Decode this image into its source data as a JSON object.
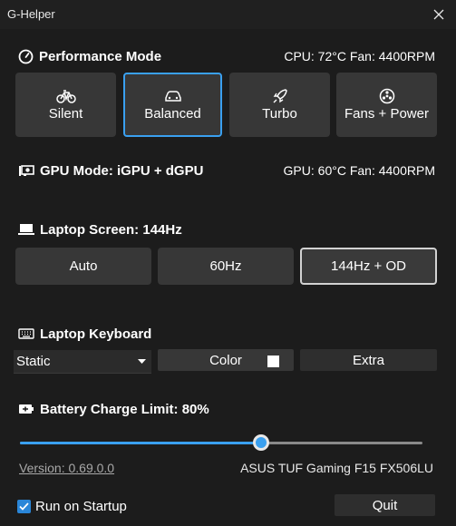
{
  "window": {
    "title": "G-Helper"
  },
  "performance": {
    "heading": "Performance Mode",
    "status": "CPU: 72°C  Fan: 4400RPM",
    "modes": [
      {
        "label": "Silent",
        "icon": "bicycle-icon"
      },
      {
        "label": "Balanced",
        "icon": "car-icon",
        "selected": true
      },
      {
        "label": "Turbo",
        "icon": "rocket-icon"
      },
      {
        "label": "Fans + Power",
        "icon": "fan-icon"
      }
    ]
  },
  "gpu": {
    "heading": "GPU Mode: iGPU + dGPU",
    "status": "GPU: 60°C  Fan: 4400RPM"
  },
  "screen": {
    "heading": "Laptop Screen: 144Hz",
    "options": [
      {
        "label": "Auto"
      },
      {
        "label": "60Hz"
      },
      {
        "label": "144Hz + OD",
        "selected": true
      }
    ]
  },
  "keyboard": {
    "heading": "Laptop Keyboard",
    "mode_value": "Static",
    "color_label": "Color",
    "extra_label": "Extra",
    "color": "#ffffff"
  },
  "battery": {
    "heading": "Battery Charge Limit: 80%",
    "limit_percent": 80,
    "slider_fraction": 0.6
  },
  "footer": {
    "version": "Version: 0.69.0.0",
    "model": "ASUS TUF Gaming F15 FX506LU",
    "startup_label": "Run on Startup",
    "startup_checked": true,
    "quit_label": "Quit"
  },
  "colors": {
    "accent": "#3aa0f0",
    "background": "#1c1c1c",
    "button": "#373737"
  }
}
